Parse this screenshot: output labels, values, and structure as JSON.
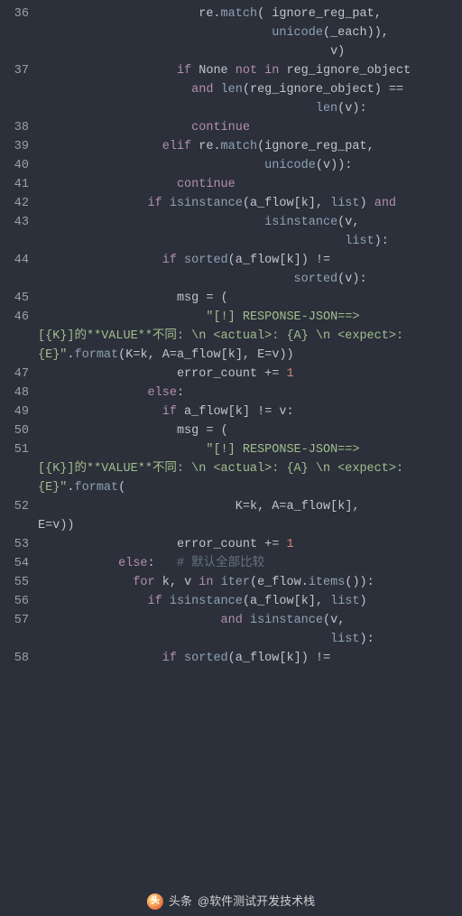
{
  "watermark": {
    "prefix": "头条",
    "handle": "@软件测试开发技术栈"
  },
  "gutter": [
    "36",
    "",
    "",
    "37",
    "",
    "",
    "38",
    "39",
    "40",
    "41",
    "42",
    "43",
    "",
    "44",
    "",
    "45",
    "46",
    "",
    "",
    "47",
    "48",
    "49",
    "50",
    "51",
    "",
    "",
    "52",
    "",
    "53",
    "54",
    "55",
    "56",
    "57",
    "",
    "58"
  ],
  "code": [
    [
      [
        "s-def",
        "                      re."
      ],
      [
        "s-fn",
        "match"
      ],
      [
        "s-par",
        "( "
      ],
      [
        "s-id",
        "ignore_reg_pat"
      ],
      [
        "s-def",
        ","
      ]
    ],
    [
      [
        "s-def",
        "                                "
      ],
      [
        "s-fn",
        "unicode"
      ],
      [
        "s-par",
        "("
      ],
      [
        "s-id",
        "_each"
      ],
      [
        "s-par",
        "))"
      ],
      [
        "s-def",
        ","
      ]
    ],
    [
      [
        "s-def",
        "                                        "
      ],
      [
        "s-id",
        "v"
      ],
      [
        "s-par",
        ")"
      ]
    ],
    [
      [
        "s-def",
        "                   "
      ],
      [
        "s-kw",
        "if"
      ],
      [
        "s-def",
        " None "
      ],
      [
        "s-kw",
        "not in"
      ],
      [
        "s-def",
        " "
      ],
      [
        "s-id",
        "reg_ignore_object"
      ]
    ],
    [
      [
        "s-def",
        "                     "
      ],
      [
        "s-kw",
        "and"
      ],
      [
        "s-def",
        " "
      ],
      [
        "s-fn",
        "len"
      ],
      [
        "s-par",
        "("
      ],
      [
        "s-id",
        "reg_ignore_object"
      ],
      [
        "s-par",
        ")"
      ],
      [
        "s-def",
        " "
      ],
      [
        "s-op",
        "=="
      ]
    ],
    [
      [
        "s-def",
        "                                      "
      ],
      [
        "s-fn",
        "len"
      ],
      [
        "s-par",
        "("
      ],
      [
        "s-id",
        "v"
      ],
      [
        "s-par",
        ")"
      ],
      [
        "s-def",
        ":"
      ]
    ],
    [
      [
        "s-def",
        "                     "
      ],
      [
        "s-kw",
        "continue"
      ]
    ],
    [
      [
        "s-def",
        "                 "
      ],
      [
        "s-kw",
        "elif"
      ],
      [
        "s-def",
        " re."
      ],
      [
        "s-fn",
        "match"
      ],
      [
        "s-par",
        "("
      ],
      [
        "s-id",
        "ignore_reg_pat"
      ],
      [
        "s-def",
        ","
      ]
    ],
    [
      [
        "s-def",
        "                               "
      ],
      [
        "s-fn",
        "unicode"
      ],
      [
        "s-par",
        "("
      ],
      [
        "s-id",
        "v"
      ],
      [
        "s-par",
        ")):"
      ]
    ],
    [
      [
        "s-def",
        "                   "
      ],
      [
        "s-kw",
        "continue"
      ]
    ],
    [
      [
        "s-def",
        "               "
      ],
      [
        "s-kw",
        "if"
      ],
      [
        "s-def",
        " "
      ],
      [
        "s-fn",
        "isinstance"
      ],
      [
        "s-par",
        "("
      ],
      [
        "s-id",
        "a_flow"
      ],
      [
        "s-par",
        "["
      ],
      [
        "s-id",
        "k"
      ],
      [
        "s-par",
        "]"
      ],
      [
        "s-def",
        ", "
      ],
      [
        "s-fn",
        "list"
      ],
      [
        "s-par",
        ")"
      ],
      [
        "s-def",
        " "
      ],
      [
        "s-kw",
        "and"
      ]
    ],
    [
      [
        "s-def",
        "                               "
      ],
      [
        "s-fn",
        "isinstance"
      ],
      [
        "s-par",
        "("
      ],
      [
        "s-id",
        "v"
      ],
      [
        "s-def",
        ","
      ]
    ],
    [
      [
        "s-def",
        "                                          "
      ],
      [
        "s-fn",
        "list"
      ],
      [
        "s-par",
        "):"
      ]
    ],
    [
      [
        "s-def",
        "                 "
      ],
      [
        "s-kw",
        "if"
      ],
      [
        "s-def",
        " "
      ],
      [
        "s-fn",
        "sorted"
      ],
      [
        "s-par",
        "("
      ],
      [
        "s-id",
        "a_flow"
      ],
      [
        "s-par",
        "["
      ],
      [
        "s-id",
        "k"
      ],
      [
        "s-par",
        "])"
      ],
      [
        "s-def",
        " "
      ],
      [
        "s-op",
        "!="
      ]
    ],
    [
      [
        "s-def",
        "                                   "
      ],
      [
        "s-fn",
        "sorted"
      ],
      [
        "s-par",
        "("
      ],
      [
        "s-id",
        "v"
      ],
      [
        "s-par",
        "):"
      ]
    ],
    [
      [
        "s-def",
        "                   "
      ],
      [
        "s-id",
        "msg"
      ],
      [
        "s-def",
        " "
      ],
      [
        "s-op",
        "="
      ],
      [
        "s-def",
        " "
      ],
      [
        "s-par",
        "("
      ]
    ],
    [
      [
        "s-def",
        "                       "
      ],
      [
        "s-str",
        "\"[!] RESPONSE-JSON==>"
      ]
    ],
    [
      [
        "s-str",
        "[{K}]的**VALUE**不同: \\n <actual>: {A} \\n <expect>:"
      ]
    ],
    [
      [
        "s-str",
        "{E}\""
      ],
      [
        "s-def",
        "."
      ],
      [
        "s-fn",
        "format"
      ],
      [
        "s-par",
        "("
      ],
      [
        "s-id",
        "K"
      ],
      [
        "s-op",
        "="
      ],
      [
        "s-id",
        "k"
      ],
      [
        "s-def",
        ", "
      ],
      [
        "s-id",
        "A"
      ],
      [
        "s-op",
        "="
      ],
      [
        "s-id",
        "a_flow"
      ],
      [
        "s-par",
        "["
      ],
      [
        "s-id",
        "k"
      ],
      [
        "s-par",
        "]"
      ],
      [
        "s-def",
        ", "
      ],
      [
        "s-id",
        "E"
      ],
      [
        "s-op",
        "="
      ],
      [
        "s-id",
        "v"
      ],
      [
        "s-par",
        "))"
      ]
    ],
    [
      [
        "s-def",
        "                   "
      ],
      [
        "s-id",
        "error_count"
      ],
      [
        "s-def",
        " "
      ],
      [
        "s-op",
        "+="
      ],
      [
        "s-def",
        " "
      ],
      [
        "s-num",
        "1"
      ]
    ],
    [
      [
        "s-def",
        "               "
      ],
      [
        "s-kw",
        "else"
      ],
      [
        "s-def",
        ":"
      ]
    ],
    [
      [
        "s-def",
        "                 "
      ],
      [
        "s-kw",
        "if"
      ],
      [
        "s-def",
        " "
      ],
      [
        "s-id",
        "a_flow"
      ],
      [
        "s-par",
        "["
      ],
      [
        "s-id",
        "k"
      ],
      [
        "s-par",
        "]"
      ],
      [
        "s-def",
        " "
      ],
      [
        "s-op",
        "!="
      ],
      [
        "s-def",
        " "
      ],
      [
        "s-id",
        "v"
      ],
      [
        "s-def",
        ":"
      ]
    ],
    [
      [
        "s-def",
        "                   "
      ],
      [
        "s-id",
        "msg"
      ],
      [
        "s-def",
        " "
      ],
      [
        "s-op",
        "="
      ],
      [
        "s-def",
        " "
      ],
      [
        "s-par",
        "("
      ]
    ],
    [
      [
        "s-def",
        "                       "
      ],
      [
        "s-str",
        "\"[!] RESPONSE-JSON==>"
      ]
    ],
    [
      [
        "s-str",
        "[{K}]的**VALUE**不同: \\n <actual>: {A} \\n <expect>:"
      ]
    ],
    [
      [
        "s-str",
        "{E}\""
      ],
      [
        "s-def",
        "."
      ],
      [
        "s-fn",
        "format"
      ],
      [
        "s-par",
        "("
      ]
    ],
    [
      [
        "s-def",
        "                           "
      ],
      [
        "s-id",
        "K"
      ],
      [
        "s-op",
        "="
      ],
      [
        "s-id",
        "k"
      ],
      [
        "s-def",
        ", "
      ],
      [
        "s-id",
        "A"
      ],
      [
        "s-op",
        "="
      ],
      [
        "s-id",
        "a_flow"
      ],
      [
        "s-par",
        "["
      ],
      [
        "s-id",
        "k"
      ],
      [
        "s-par",
        "]"
      ],
      [
        "s-def",
        ","
      ]
    ],
    [
      [
        "s-id",
        "E"
      ],
      [
        "s-op",
        "="
      ],
      [
        "s-id",
        "v"
      ],
      [
        "s-par",
        "))"
      ]
    ],
    [
      [
        "s-def",
        "                   "
      ],
      [
        "s-id",
        "error_count"
      ],
      [
        "s-def",
        " "
      ],
      [
        "s-op",
        "+="
      ],
      [
        "s-def",
        " "
      ],
      [
        "s-num",
        "1"
      ]
    ],
    [
      [
        "s-def",
        "           "
      ],
      [
        "s-kw",
        "else"
      ],
      [
        "s-def",
        ":   "
      ],
      [
        "s-cmt",
        "# 默认全部比较"
      ]
    ],
    [
      [
        "s-def",
        "             "
      ],
      [
        "s-kw",
        "for"
      ],
      [
        "s-def",
        " "
      ],
      [
        "s-id",
        "k"
      ],
      [
        "s-def",
        ", "
      ],
      [
        "s-id",
        "v"
      ],
      [
        "s-def",
        " "
      ],
      [
        "s-kw",
        "in"
      ],
      [
        "s-def",
        " "
      ],
      [
        "s-fn",
        "iter"
      ],
      [
        "s-par",
        "("
      ],
      [
        "s-id",
        "e_flow"
      ],
      [
        "s-def",
        "."
      ],
      [
        "s-fn",
        "items"
      ],
      [
        "s-par",
        "()):"
      ]
    ],
    [
      [
        "s-def",
        "               "
      ],
      [
        "s-kw",
        "if"
      ],
      [
        "s-def",
        " "
      ],
      [
        "s-fn",
        "isinstance"
      ],
      [
        "s-par",
        "("
      ],
      [
        "s-id",
        "a_flow"
      ],
      [
        "s-par",
        "["
      ],
      [
        "s-id",
        "k"
      ],
      [
        "s-par",
        "]"
      ],
      [
        "s-def",
        ", "
      ],
      [
        "s-fn",
        "list"
      ],
      [
        "s-par",
        ")"
      ]
    ],
    [
      [
        "s-def",
        "                         "
      ],
      [
        "s-kw",
        "and"
      ],
      [
        "s-def",
        " "
      ],
      [
        "s-fn",
        "isinstance"
      ],
      [
        "s-par",
        "("
      ],
      [
        "s-id",
        "v"
      ],
      [
        "s-def",
        ","
      ]
    ],
    [
      [
        "s-def",
        "                                        "
      ],
      [
        "s-fn",
        "list"
      ],
      [
        "s-par",
        "):"
      ]
    ],
    [
      [
        "s-def",
        "                 "
      ],
      [
        "s-kw",
        "if"
      ],
      [
        "s-def",
        " "
      ],
      [
        "s-fn",
        "sorted"
      ],
      [
        "s-par",
        "("
      ],
      [
        "s-id",
        "a_flow"
      ],
      [
        "s-par",
        "["
      ],
      [
        "s-id",
        "k"
      ],
      [
        "s-par",
        "])"
      ],
      [
        "s-def",
        " "
      ],
      [
        "s-op",
        "!="
      ]
    ]
  ]
}
